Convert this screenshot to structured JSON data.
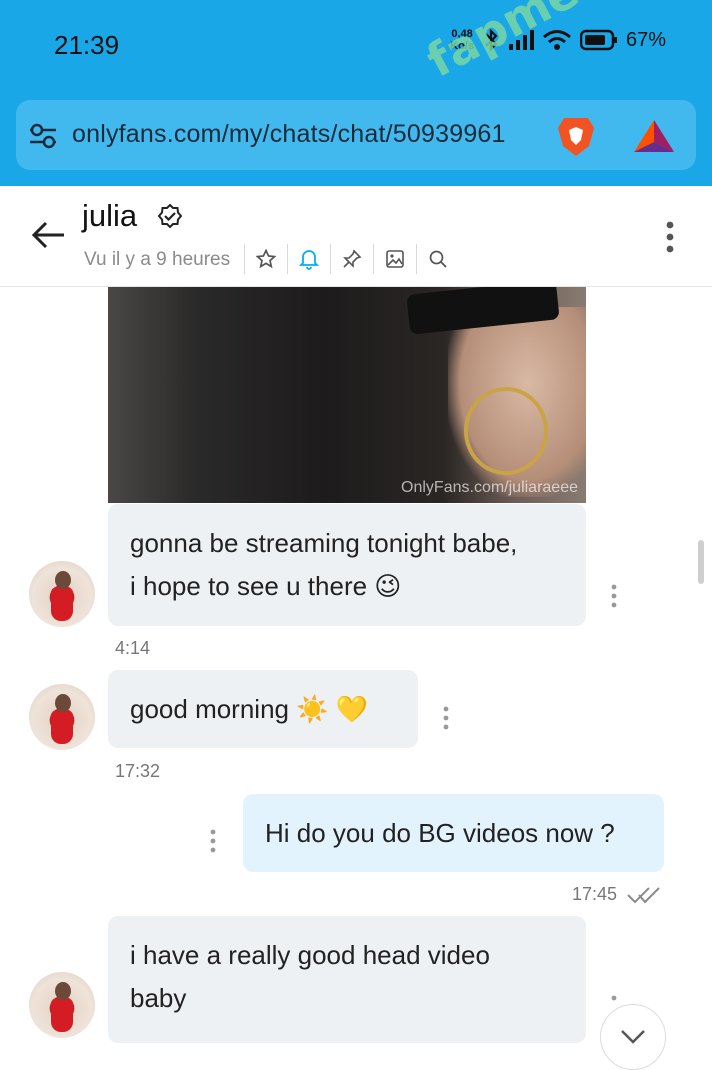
{
  "status_bar": {
    "time": "21:39",
    "net_speed_value": "0,48",
    "net_speed_unit": "Ko/s",
    "battery": "67%"
  },
  "browser": {
    "url": "onlyfans.com/my/chats/chat/50939961",
    "watermark": "fapmenu.com"
  },
  "chat_header": {
    "name": "julia",
    "last_seen": "Vu il y a 9 heures"
  },
  "photo": {
    "credit": "OnlyFans.com/juliaraeee"
  },
  "messages": [
    {
      "line1": "gonna be streaming tonight babe,",
      "line2": "i hope to see u there 😉",
      "time": "4:14"
    },
    {
      "text": "good morning ☀️ 💛",
      "time": "17:32"
    },
    {
      "text": "Hi do you do BG videos now ?",
      "time": "17:45"
    },
    {
      "line1": "i have a really good head video",
      "line2": "baby"
    }
  ],
  "colors": {
    "browser_bar": "#1aa7e8",
    "url_field": "#41b9ef",
    "incoming_bubble": "#eef1f4",
    "outgoing_bubble": "#e3f3fd",
    "accent": "#00aff0"
  },
  "icons": [
    "tune-icon",
    "brave-lion-icon",
    "bat-triangle-icon",
    "back-arrow-icon",
    "verified-icon",
    "star-icon",
    "bell-icon",
    "pin-icon",
    "media-icon",
    "search-icon",
    "more-vert-icon",
    "double-check-icon",
    "chevron-down-icon"
  ]
}
